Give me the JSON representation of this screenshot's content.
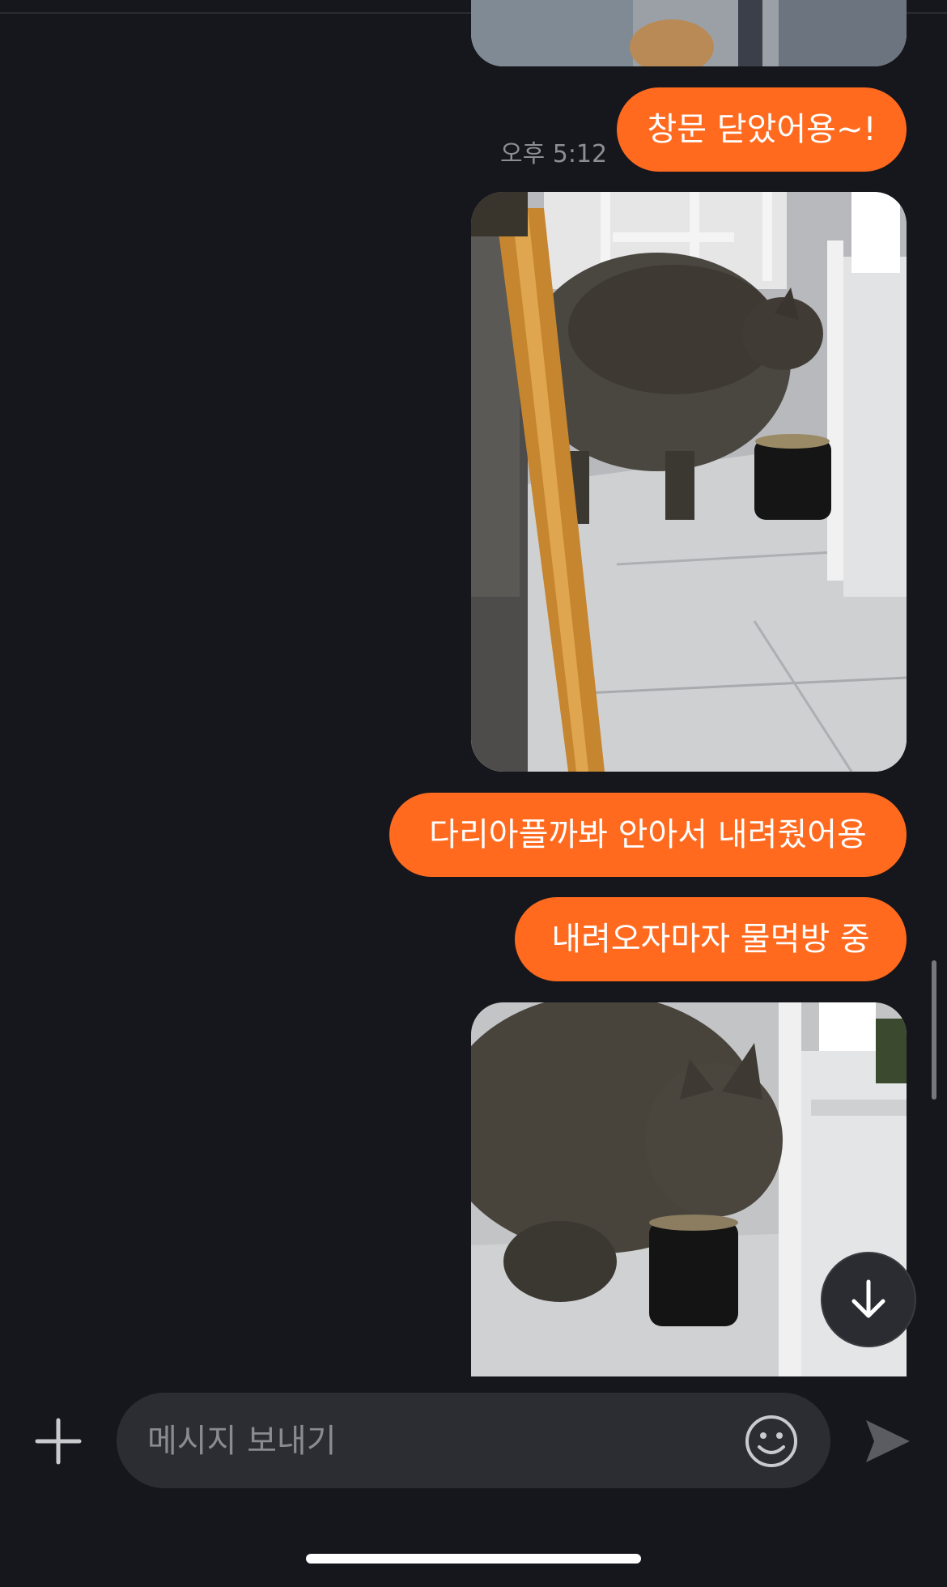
{
  "messages": [
    {
      "type": "photo",
      "alt": "cat photo (cropped top)"
    },
    {
      "type": "text",
      "text": "창문 닫았어용~!",
      "time": "오후 5:12"
    },
    {
      "type": "photo",
      "alt": "cat photo"
    },
    {
      "type": "text",
      "text": "다리아플까봐 안아서 내려줬어용"
    },
    {
      "type": "text",
      "text": "내려오자마자 물먹방 중"
    },
    {
      "type": "photo",
      "alt": "cat drinking photo"
    }
  ],
  "composer": {
    "placeholder": "메시지 보내기",
    "add_icon": "plus-icon",
    "emoji_icon": "smiley-icon",
    "send_icon": "send-icon"
  },
  "scroll_down_icon": "arrow-down-icon",
  "colors": {
    "bubble": "#ff6a1f",
    "background": "#16171c",
    "input": "#2c2d33"
  }
}
